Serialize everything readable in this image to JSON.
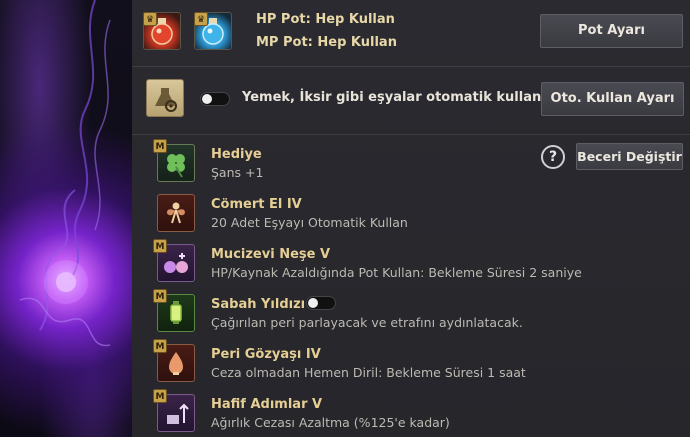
{
  "potions": {
    "hp_label": "HP Pot: Hep Kullan",
    "mp_label": "MP Pot: Hep Kullan",
    "settings_button": "Pot Ayarı"
  },
  "auto_use": {
    "text": "Yemek, İksir gibi eşyalar otomatik kullanılır.",
    "button": "Oto. Kullan Ayarı",
    "toggle_on": false
  },
  "skills_header": {
    "help_glyph": "?",
    "change_button": "Beceri Değiştir"
  },
  "skills": [
    {
      "badge": "M",
      "name": "Hediye",
      "desc": "Şans +1",
      "icon": "clover-icon"
    },
    {
      "badge": "",
      "name": "Cömert El IV",
      "desc": "20 Adet Eşyayı Otomatik Kullan",
      "icon": "fairy-icon"
    },
    {
      "badge": "M",
      "name": "Mucizevi Neşe V",
      "desc": "HP/Kaynak Azaldığında Pot Kullan: Bekleme Süresi 2 saniye",
      "icon": "potion-cluster-icon"
    },
    {
      "badge": "M",
      "name": "Sabah Yıldızı",
      "desc": "Çağırılan peri parlayacak ve etrafını aydınlatacak.",
      "icon": "lantern-icon",
      "toggle_on": false
    },
    {
      "badge": "M",
      "name": "Peri Gözyaşı IV",
      "desc": "Ceza olmadan Hemen Diril: Bekleme Süresi 1 saat",
      "icon": "tear-vial-icon"
    },
    {
      "badge": "M",
      "name": "Hafif Adımlar V",
      "desc": "Ağırlık Cezası Azaltma (%125'e kadar)",
      "icon": "weight-icon"
    }
  ]
}
